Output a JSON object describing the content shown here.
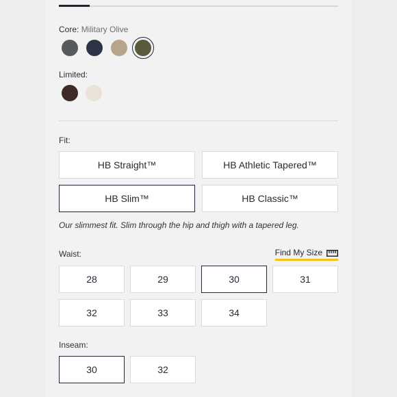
{
  "progress": {
    "fraction": 0.11
  },
  "color": {
    "core_label": "Core:",
    "core_selected": "Military Olive",
    "core_swatches": [
      {
        "name": "charcoal",
        "hex": "#56595e"
      },
      {
        "name": "navy",
        "hex": "#2e3346"
      },
      {
        "name": "khaki",
        "hex": "#b7a48a"
      },
      {
        "name": "military-olive",
        "hex": "#5a5a3d",
        "selected": true
      }
    ],
    "limited_label": "Limited:",
    "limited_swatches": [
      {
        "name": "dark-brown",
        "hex": "#3e2b28"
      },
      {
        "name": "cream",
        "hex": "#e8e2d9"
      }
    ]
  },
  "fit": {
    "label": "Fit:",
    "options": [
      {
        "label": "HB Straight™",
        "selected": false
      },
      {
        "label": "HB Athletic Tapered™",
        "selected": false
      },
      {
        "label": "HB Slim™",
        "selected": true
      },
      {
        "label": "HB Classic™",
        "selected": false
      }
    ],
    "description": "Our slimmest fit. Slim through the hip and thigh with a tapered leg."
  },
  "waist": {
    "label": "Waist:",
    "find_my_size": "Find My Size",
    "options": [
      {
        "label": "28",
        "selected": false
      },
      {
        "label": "29",
        "selected": false
      },
      {
        "label": "30",
        "selected": true
      },
      {
        "label": "31",
        "selected": false
      },
      {
        "label": "32",
        "selected": false
      },
      {
        "label": "33",
        "selected": false
      },
      {
        "label": "34",
        "selected": false
      }
    ]
  },
  "inseam": {
    "label": "Inseam:",
    "options": [
      {
        "label": "30",
        "selected": true
      },
      {
        "label": "32",
        "selected": false
      }
    ]
  },
  "colors": {
    "accent_underline": "#f2c21b",
    "selected_border": "#1d2433"
  }
}
